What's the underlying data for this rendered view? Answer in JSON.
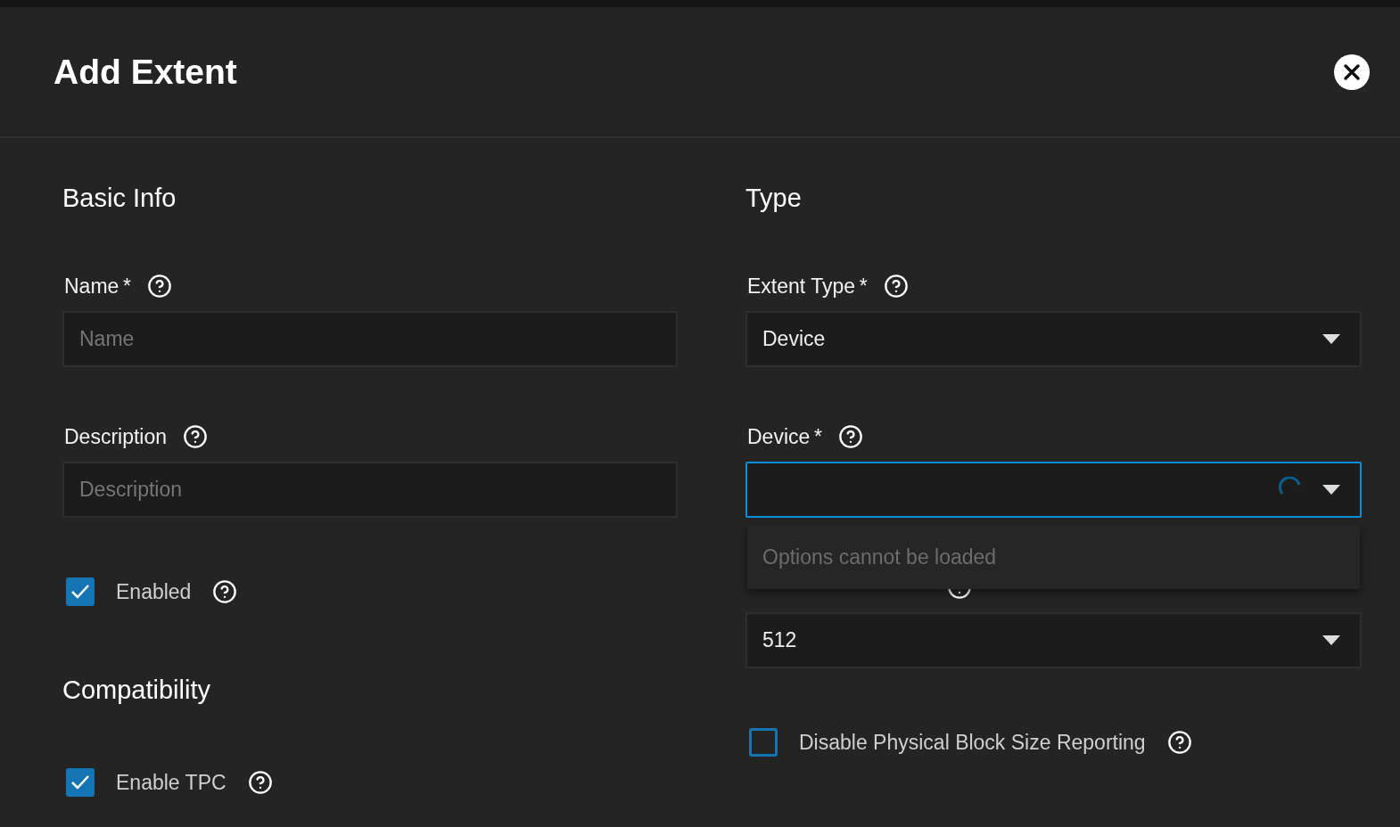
{
  "dialog": {
    "title": "Add Extent"
  },
  "columns": [
    {
      "sections": [
        {
          "title": "Basic Info",
          "fields": [
            {
              "kind": "text",
              "label": "Name",
              "required_mark": "*",
              "placeholder": "Name"
            },
            {
              "kind": "text",
              "label": "Description",
              "placeholder": "Description"
            },
            {
              "kind": "checkbox",
              "label": "Enabled",
              "checked": true
            }
          ]
        },
        {
          "title": "Compatibility",
          "fields": [
            {
              "kind": "checkbox",
              "label": "Enable TPC",
              "checked": true
            }
          ]
        }
      ]
    },
    {
      "sections": [
        {
          "title": "Type",
          "fields": [
            {
              "kind": "select",
              "label": "Extent Type",
              "required_mark": "*",
              "value": "Device",
              "focused": false,
              "loading": false
            },
            {
              "kind": "select",
              "label": "Device",
              "required_mark": "*",
              "focused": true,
              "loading": true,
              "message": "Options cannot be loaded"
            },
            {
              "kind": "select",
              "value": "512",
              "focused": false,
              "loading": false
            },
            {
              "kind": "checkbox",
              "label": "Disable Physical Block Size Reporting",
              "checked": false
            }
          ]
        }
      ]
    }
  ]
}
